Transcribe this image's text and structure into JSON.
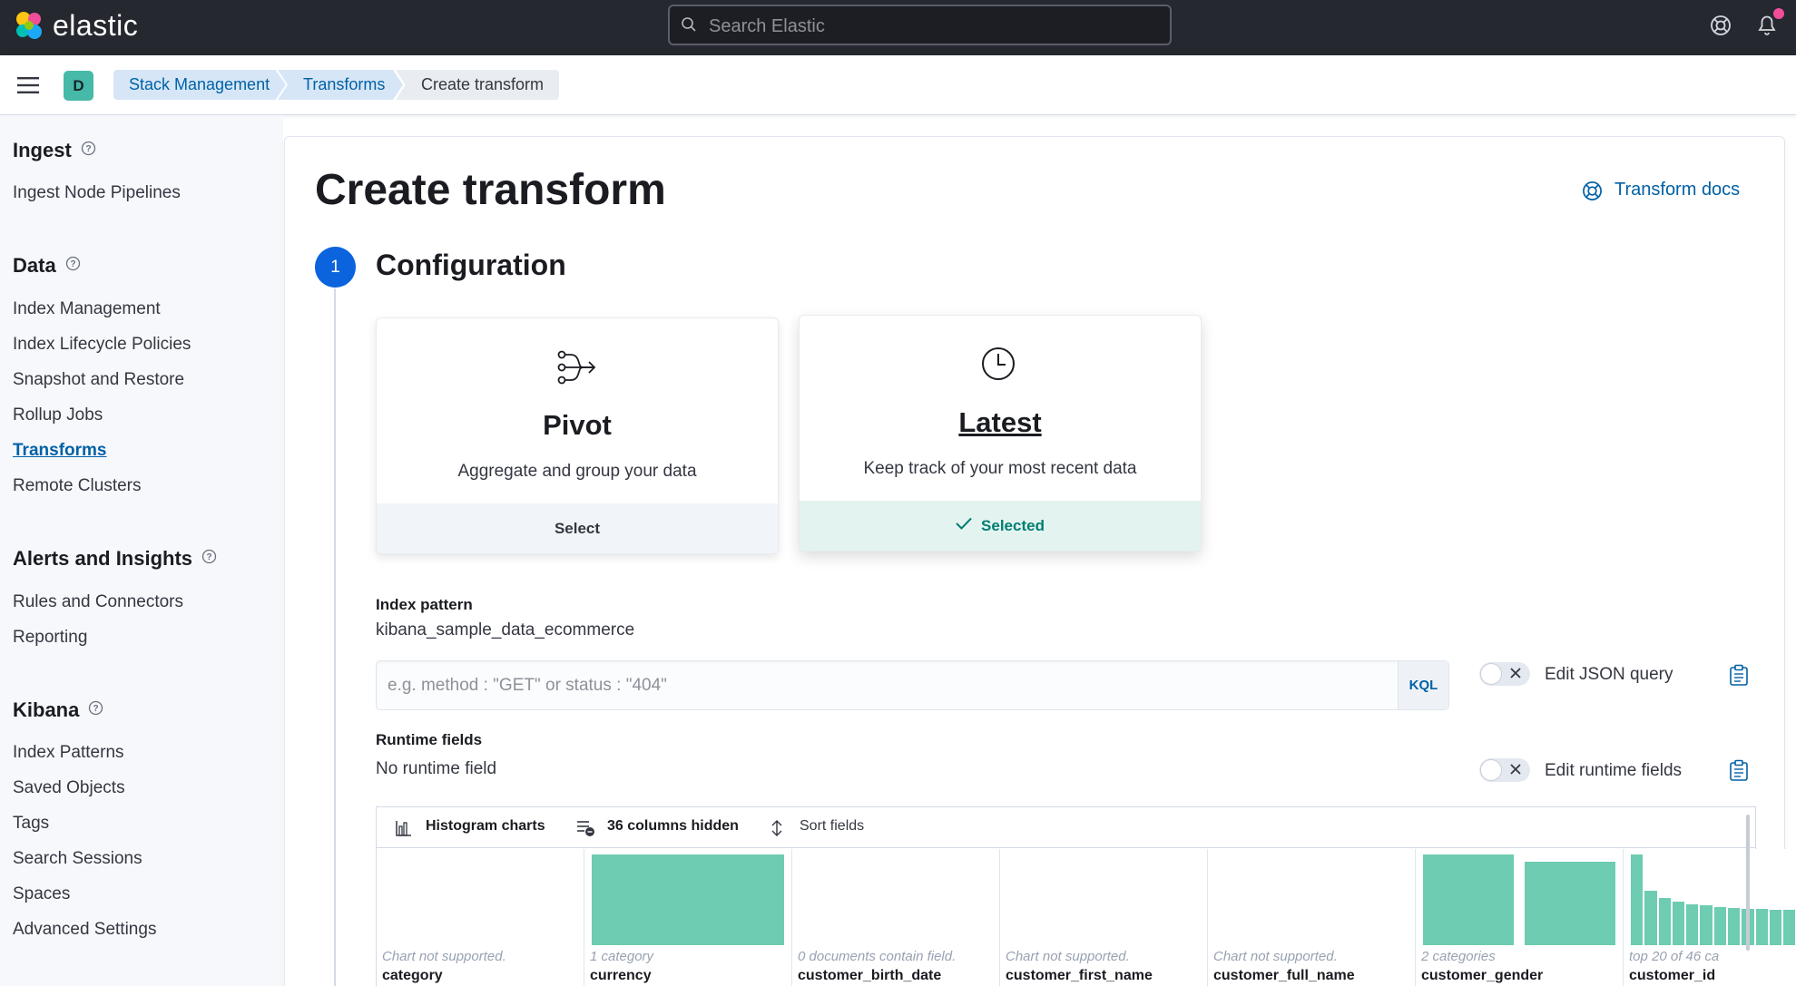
{
  "header": {
    "logo_text": "elastic",
    "search_placeholder": "Search Elastic"
  },
  "breadcrumbs": {
    "space_initial": "D",
    "items": [
      "Stack Management",
      "Transforms",
      "Create transform"
    ]
  },
  "sidebar": {
    "sections": [
      {
        "title": "Ingest",
        "items": [
          "Ingest Node Pipelines"
        ]
      },
      {
        "title": "Data",
        "items": [
          "Index Management",
          "Index Lifecycle Policies",
          "Snapshot and Restore",
          "Rollup Jobs",
          "Transforms",
          "Remote Clusters"
        ]
      },
      {
        "title": "Alerts and Insights",
        "items": [
          "Rules and Connectors",
          "Reporting"
        ]
      },
      {
        "title": "Kibana",
        "items": [
          "Index Patterns",
          "Saved Objects",
          "Tags",
          "Search Sessions",
          "Spaces",
          "Advanced Settings"
        ]
      }
    ],
    "active_item": "Transforms"
  },
  "page": {
    "title": "Create transform",
    "docs_link": "Transform docs",
    "step_number": "1",
    "step_title": "Configuration"
  },
  "cards": {
    "pivot": {
      "title": "Pivot",
      "description": "Aggregate and group your data",
      "action": "Select"
    },
    "latest": {
      "title": "Latest",
      "description": "Keep track of your most recent data",
      "action": "Selected"
    }
  },
  "index_pattern": {
    "label": "Index pattern",
    "value": "kibana_sample_data_ecommerce"
  },
  "query": {
    "placeholder": "e.g. method : \"GET\" or status : \"404\"",
    "language": "KQL",
    "edit_json_label": "Edit JSON query",
    "edit_json_enabled": false
  },
  "runtime": {
    "label": "Runtime fields",
    "value": "No runtime field",
    "edit_label": "Edit runtime fields",
    "edit_enabled": false
  },
  "grid": {
    "toolbar": {
      "histogram": "Histogram charts",
      "columns_hidden": "36 columns hidden",
      "sort": "Sort fields"
    },
    "columns": [
      {
        "name": "category",
        "note": "Chart not supported.",
        "bars": []
      },
      {
        "name": "currency",
        "note": "1 category",
        "bars": [
          1.0
        ]
      },
      {
        "name": "customer_birth_date",
        "note": "0 documents contain field.",
        "bars": []
      },
      {
        "name": "customer_first_name",
        "note": "Chart not supported.",
        "bars": []
      },
      {
        "name": "customer_full_name",
        "note": "Chart not supported.",
        "bars": []
      },
      {
        "name": "customer_gender",
        "note": "2 categories",
        "bars": [
          1.0,
          0.92
        ]
      },
      {
        "name": "customer_id",
        "note": "top 20 of 46 ca",
        "bars": [
          1.0,
          0.6,
          0.52,
          0.48,
          0.45,
          0.44,
          0.42,
          0.41,
          0.4,
          0.4,
          0.39,
          0.39,
          0.38,
          0.38
        ]
      }
    ]
  },
  "colors": {
    "accent": "#0061a6",
    "header_bg": "#25282f",
    "step_blue": "#0b64dd",
    "selected_green": "#017d73",
    "bar_green": "#6dccb1"
  }
}
